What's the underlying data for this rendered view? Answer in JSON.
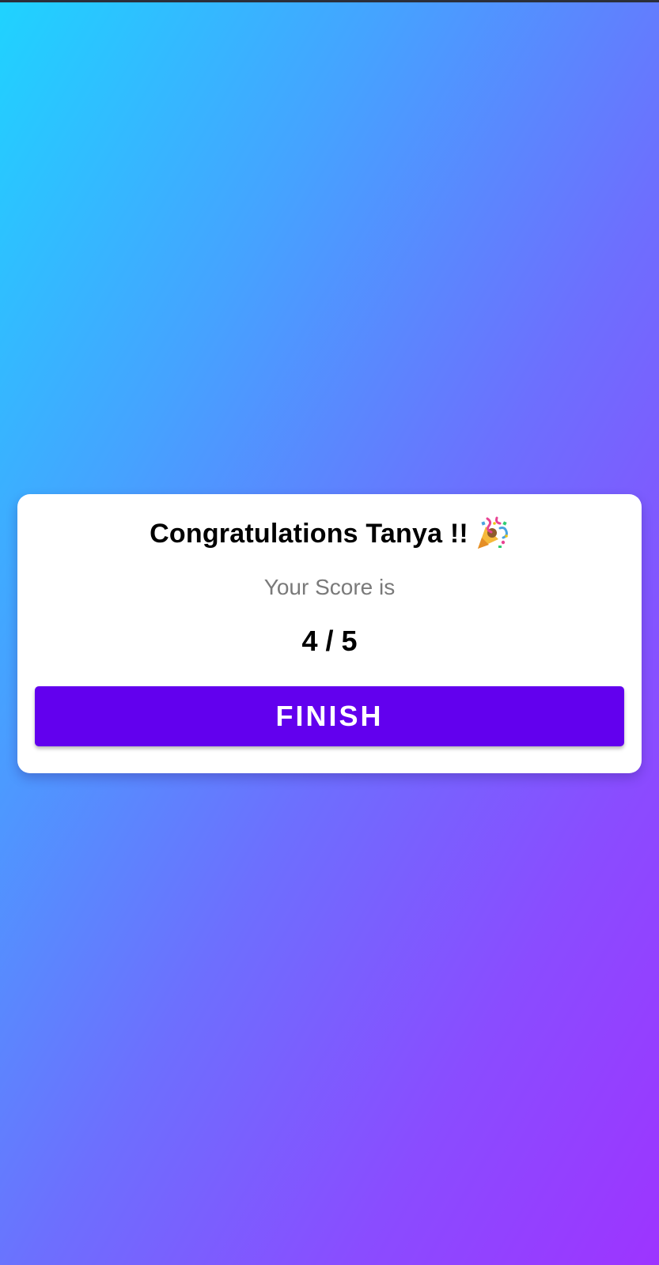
{
  "result": {
    "title": "Congratulations Tanya !!",
    "title_icon": "party-popper-icon",
    "subtitle": "Your Score is",
    "score": "4 / 5",
    "finish_label": "FINISH"
  },
  "colors": {
    "gradient_start": "#1fd3ff",
    "gradient_end": "#9d34ff",
    "button": "#6200ee",
    "card": "#ffffff",
    "subtitle_text": "#7a7a7a"
  }
}
